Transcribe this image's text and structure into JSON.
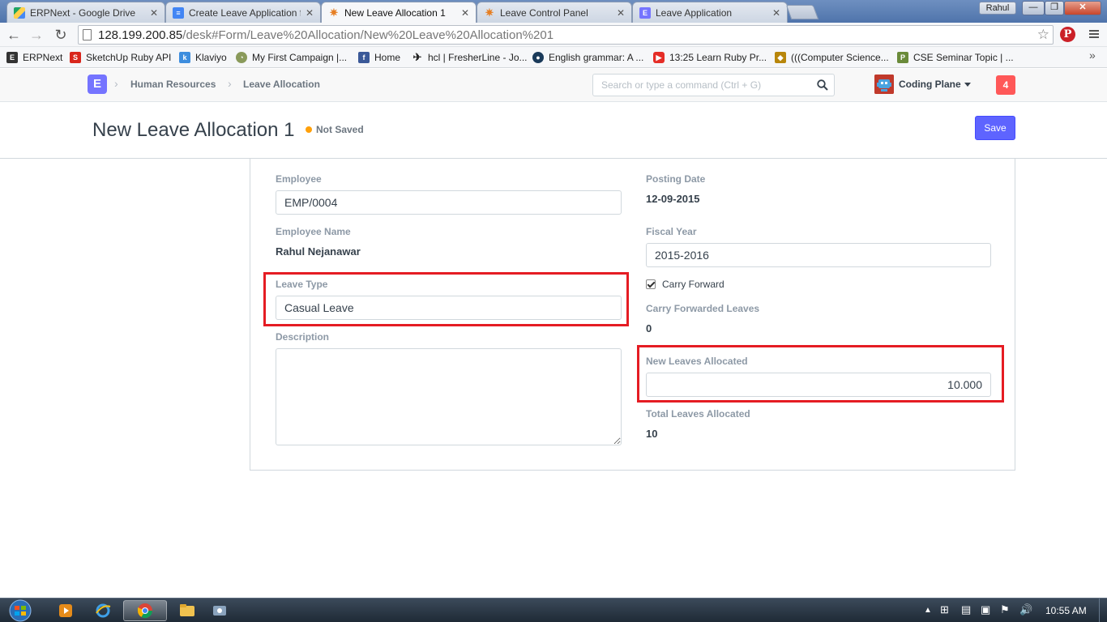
{
  "browser": {
    "tabs": [
      {
        "label": "ERPNext - Google Drive",
        "icon": "google-drive-icon"
      },
      {
        "label": "Create Leave Application f",
        "icon": "docs-icon"
      },
      {
        "label": "New Leave Allocation 1",
        "icon": "erpnext-icon",
        "active": true
      },
      {
        "label": "Leave Control Panel",
        "icon": "erpnext-icon"
      },
      {
        "label": "Leave Application",
        "icon": "erpnext-e-icon"
      }
    ],
    "user": "Rahul",
    "url_host": "128.199.200.85",
    "url_path": "/desk#Form/Leave%20Allocation/New%20Leave%20Allocation%201",
    "bookmarks": [
      {
        "label": "ERPNext",
        "icon": "erpnext-e-icon"
      },
      {
        "label": "SketchUp Ruby API",
        "icon": "sketchup-icon"
      },
      {
        "label": "Klaviyo",
        "icon": "klaviyo-icon"
      },
      {
        "label": "My First Campaign |...",
        "icon": "campaign-icon"
      },
      {
        "label": "Home",
        "icon": "facebook-icon"
      },
      {
        "label": "hcl | FresherLine - Jo...",
        "icon": "fresherline-icon"
      },
      {
        "label": "English grammar: A ...",
        "icon": "grammar-icon"
      },
      {
        "label": "13:25 Learn Ruby Pr...",
        "icon": "youtube-icon"
      },
      {
        "label": "(((Computer Science...",
        "icon": "cs-icon"
      },
      {
        "label": "CSE Seminar Topic | ...",
        "icon": "seminar-icon"
      }
    ]
  },
  "app": {
    "logo": "E",
    "breadcrumbs": [
      "Human Resources",
      "Leave Allocation"
    ],
    "search_placeholder": "Search or type a command (Ctrl + G)",
    "username": "Coding Plane",
    "notifications": "4"
  },
  "page": {
    "title": "New Leave Allocation 1",
    "status": "Not Saved",
    "save_label": "Save"
  },
  "form": {
    "employee": {
      "label": "Employee",
      "value": "EMP/0004"
    },
    "employee_name": {
      "label": "Employee Name",
      "value": "Rahul Nejanawar"
    },
    "leave_type": {
      "label": "Leave Type",
      "value": "Casual Leave"
    },
    "description": {
      "label": "Description",
      "value": ""
    },
    "posting_date": {
      "label": "Posting Date",
      "value": "12-09-2015"
    },
    "fiscal_year": {
      "label": "Fiscal Year",
      "value": "2015-2016"
    },
    "carry_forward": {
      "label": "Carry Forward",
      "checked": true
    },
    "carry_forwarded_leaves": {
      "label": "Carry Forwarded Leaves",
      "value": "0"
    },
    "new_leaves_allocated": {
      "label": "New Leaves Allocated",
      "value": "10.000"
    },
    "total_leaves_allocated": {
      "label": "Total Leaves Allocated",
      "value": "10"
    }
  },
  "taskbar": {
    "clock": "10:55 AM"
  },
  "colors": {
    "primary": "#5e64ff",
    "highlight": "#e51c23",
    "indicator_orange": "#ffa00a",
    "notification_red": "#ff5858"
  }
}
